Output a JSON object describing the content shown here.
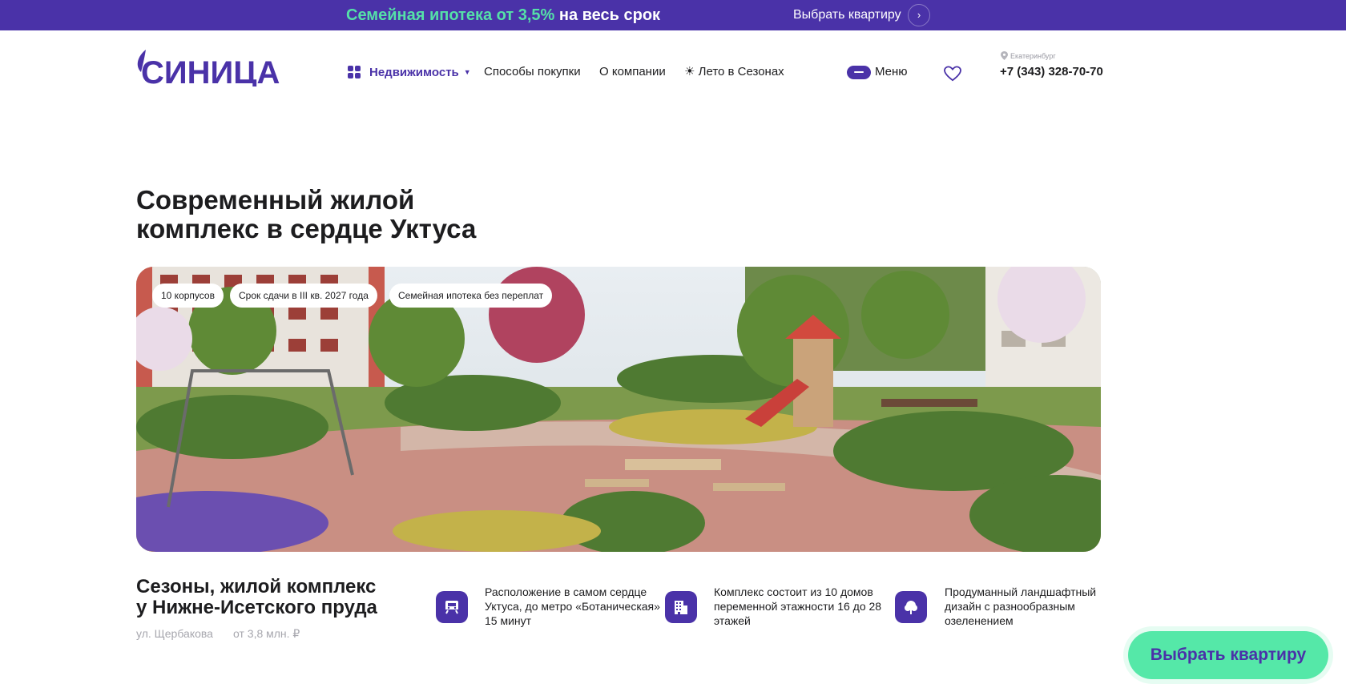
{
  "promo": {
    "accent": "Семейная ипотека от 3,5%",
    "rest": " на весь срок",
    "cta": "Выбрать квартиру",
    "arrow": "›"
  },
  "header": {
    "logo_text": "СИНИЦА",
    "nav": [
      {
        "label": "Недвижимость",
        "icon": "grid-icon",
        "has_dropdown": true
      },
      {
        "label": "Способы покупки"
      },
      {
        "label": "О компании"
      },
      {
        "label": "Лето в Сезонах",
        "prefix": "☀"
      }
    ],
    "menu_label": "Меню",
    "city": "Екатеринбург",
    "phone": "+7 (343) 328-70-70"
  },
  "hero": {
    "title_line1": "Современный жилой",
    "title_line2": "комплекс в сердце Уктуса",
    "tags": [
      "10 корпусов",
      "Срок сдачи в III кв. 2027 года",
      "Семейная ипотека без переплат"
    ]
  },
  "complex": {
    "title_line1": "Сезоны, жилой комплекс",
    "title_line2": "у Нижне-Исетского пруда",
    "address": "ул. Щербакова",
    "price": "от 3,8 млн. ₽"
  },
  "features": [
    {
      "icon": "metro-icon",
      "text": "Расположение в самом сердце Уктуса, до метро «Ботаническая» 15 минут"
    },
    {
      "icon": "building-icon",
      "text": "Комплекс состоит из 10 домов переменной этажности 16 до 28 этажей"
    },
    {
      "icon": "tree-icon",
      "text": "Продуманный ландшафтный дизайн с разнообразным озеленением"
    }
  ],
  "cta": {
    "label": "Выбрать квартиру"
  },
  "colors": {
    "brand": "#4a32a8",
    "accent_green": "#55e8a8",
    "muted": "#a7a7ae"
  }
}
